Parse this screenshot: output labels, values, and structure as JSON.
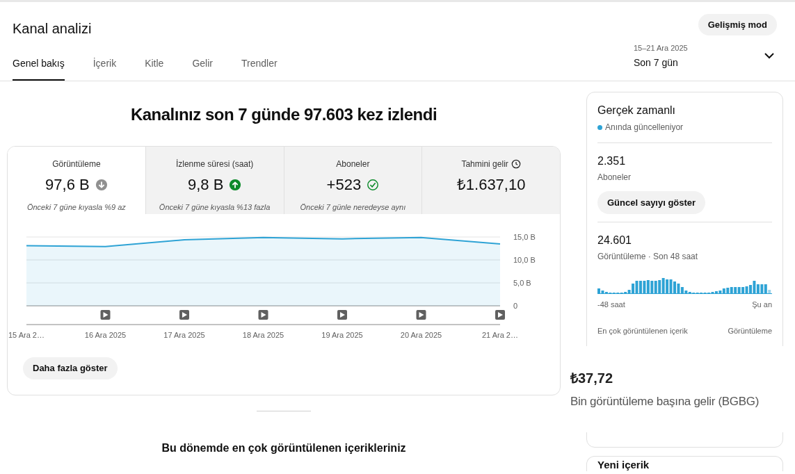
{
  "header": {
    "title": "Kanal analizi",
    "advanced_button": "Gelişmiş mod"
  },
  "tabs": [
    {
      "label": "Genel bakış",
      "selected": true
    },
    {
      "label": "İçerik",
      "selected": false
    },
    {
      "label": "Kitle",
      "selected": false
    },
    {
      "label": "Gelir",
      "selected": false
    },
    {
      "label": "Trendler",
      "selected": false
    }
  ],
  "date_range": {
    "range": "15–21 Ara 2025",
    "label": "Son 7 gün"
  },
  "headline": "Kanalınız son 7 günde 97.603 kez izlendi",
  "metrics": [
    {
      "label": "Görüntüleme",
      "value": "97,6 B",
      "kind": "decrease",
      "note": "Önceki 7 güne kıyasla %9 az",
      "selected": true
    },
    {
      "label": "İzlenme süresi (saat)",
      "value": "9,8 B",
      "kind": "increase",
      "note": "Önceki 7 güne kıyasla %13 fazla",
      "selected": false
    },
    {
      "label": "Aboneler",
      "value": "+523",
      "kind": "steady",
      "note": "Önceki 7 günle neredeyse aynı",
      "selected": false
    },
    {
      "label": "Tahmini gelir",
      "value": "₺1.637,10",
      "kind": "estimate",
      "selected": false
    }
  ],
  "chart_data": {
    "type": "line",
    "categories": [
      "15 Ara 2…",
      "16 Ara 2025",
      "17 Ara 2025",
      "18 Ara 2025",
      "19 Ara 2025",
      "20 Ara 2025",
      "21 Ara 2…"
    ],
    "series": [
      {
        "color": "#2ea3d5",
        "values": [
          13.1,
          12.9,
          14.4,
          14.9,
          14.6,
          14.9,
          13.5
        ]
      }
    ],
    "ylim": [
      0,
      15
    ],
    "yticks": [
      {
        "value": 0,
        "label": "0"
      },
      {
        "value": 5,
        "label": "5,0 B"
      },
      {
        "value": 10,
        "label": "10,0 B"
      },
      {
        "value": 15,
        "label": "15,0 B"
      }
    ]
  },
  "more_button": "Daha fazla göster",
  "top_content_title": "Bu dönemde en çok görüntülenen içerikleriniz",
  "realtime": {
    "title": "Gerçek zamanlı",
    "status": {
      "text": "Anında güncelleniyor",
      "color": "#2ea3d5"
    },
    "subscribers": "2.351",
    "subscribers_label": "Aboneler",
    "count_button": "Güncel sayıyı göster",
    "views": "24.601",
    "views_label": "Görüntüleme · Son 48 saat",
    "axis_start": "-48 saat",
    "axis_end": "Şu an",
    "table_header": "En çok görüntülenen içerik",
    "table_metric": "Görüntüleme"
  },
  "rpm_overlay": {
    "value": "₺37,72",
    "label": "Bin görüntüleme başına gelir (BGBG)"
  },
  "new_content": {
    "title": "Yeni içerik"
  }
}
